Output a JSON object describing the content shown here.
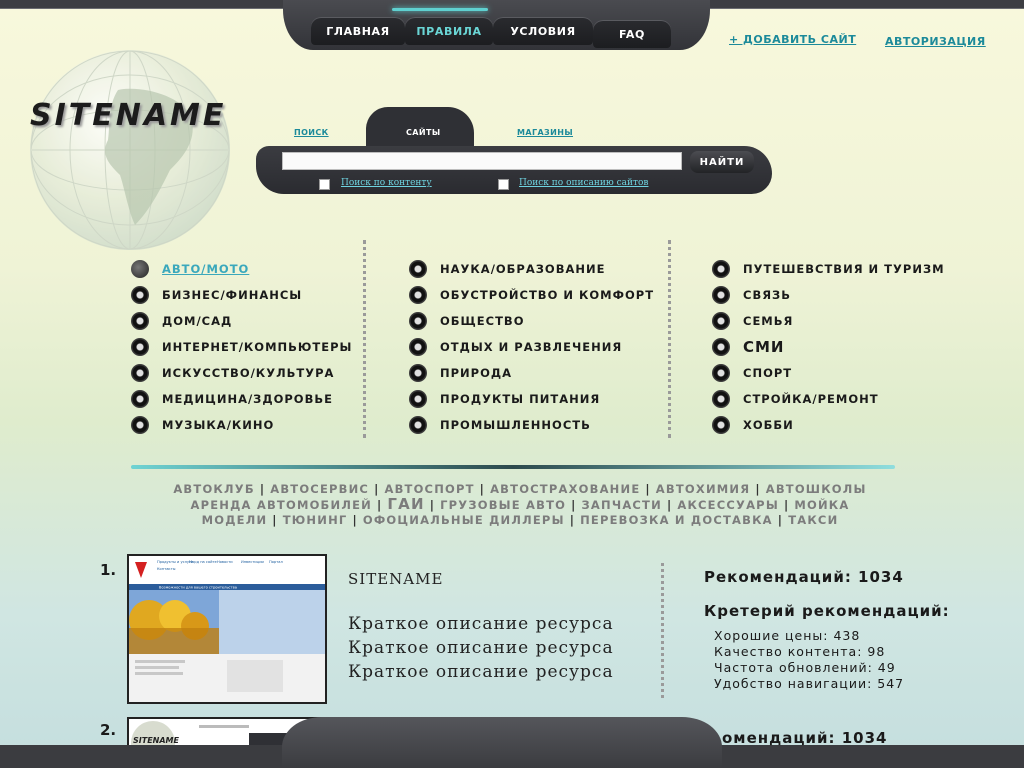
{
  "nav": {
    "tabs": [
      {
        "label": "ГЛАВНАЯ"
      },
      {
        "label": "ПРАВИЛА"
      },
      {
        "label": "УСЛОВИЯ"
      },
      {
        "label": "FAQ"
      }
    ],
    "add_site": "+ ДОБАВИТЬ САЙТ",
    "auth": "АВТОРИЗАЦИЯ"
  },
  "logo": {
    "text": "SITENAME"
  },
  "search": {
    "tabs": [
      {
        "label": "ПОИСК"
      },
      {
        "label": "САЙТЫ"
      },
      {
        "label": "МАГАЗИНЫ"
      }
    ],
    "input_value": "",
    "button": "НАЙТИ",
    "option1": "Поиск по контенту",
    "option2": "Поиск по описанию сайтов"
  },
  "categories": {
    "col1": [
      "авто/мото",
      "бизнес/финансы",
      "дом/сад",
      "интернет/компьютеры",
      "искусство/культура",
      "медицина/здоровье",
      "музыка/кино"
    ],
    "col2": [
      "наука/образование",
      "обустройство и комфорт",
      "общество",
      "отдых и развлечения",
      "природа",
      "продукты питания",
      "промышленность"
    ],
    "col3": [
      "путешевствия и туризм",
      "связь",
      "семья",
      "СМИ",
      "спорт",
      "стройка/ремонт",
      "хобби"
    ]
  },
  "tags": {
    "line1": [
      "автоклуб",
      "автосервис",
      "автоспорт",
      "автострахование",
      "автохимия",
      "автошколы"
    ],
    "line2": [
      "аренда автомобилей",
      "ГАИ",
      "грузовые авто",
      "запчасти",
      "аксессуары",
      "мойка"
    ],
    "line3": [
      "модели",
      "тюнинг",
      "офоциальные диллеры",
      "перевозка и доставка",
      "такси"
    ]
  },
  "results": [
    {
      "num": "1.",
      "title": "SITENAME",
      "desc": [
        "Краткое описание ресурса",
        "Краткое описание ресурса",
        "Краткое описание ресурса"
      ],
      "rec": "Рекомендаций: 1034",
      "crit_head": "Кретерий рекомендаций:",
      "crit": [
        "Хорошие цены: 438",
        "Качество контента: 98",
        "Частота обновлений: 49",
        "Удобство навигации: 547"
      ]
    },
    {
      "num": "2.",
      "rec": "омендаций: 1034"
    }
  ],
  "thumb1": {
    "nav_items": [
      "Продукты и услуги",
      "Морд на сайте",
      "Новости",
      "Инвестиции",
      "Портал",
      "Контакты"
    ],
    "tagline": "Возможности для вашего строительства"
  },
  "thumb2": {
    "logo": "SITENAME"
  },
  "colors": {
    "accent": "#1c8a9a",
    "accent_light": "#6ad5d5",
    "dark": "#3b3c40"
  }
}
